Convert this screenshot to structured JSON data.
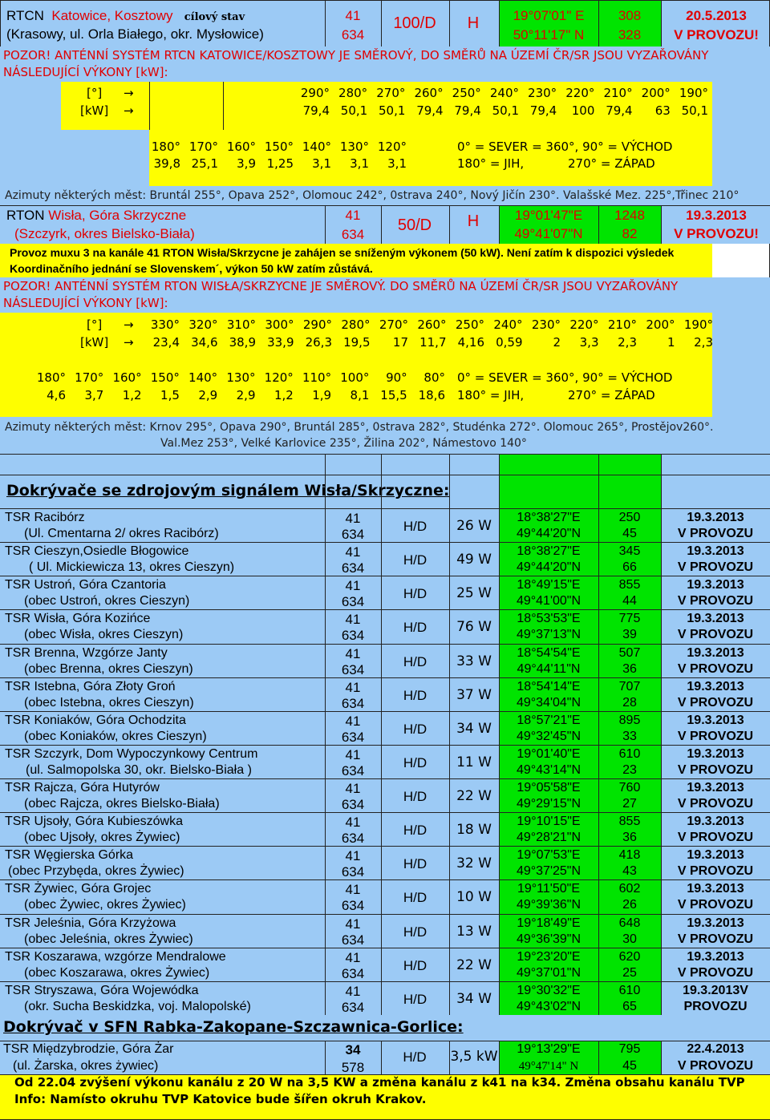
{
  "top": {
    "name1_prefix": "RTCN",
    "name1_city": "Katowice, Kosztowy",
    "name1_tag": "cílový stav",
    "name2": "(Krasowy, ul. Orla Białego, okr. Mysłowice)",
    "ch": "41",
    "freq": "634",
    "pol": "100/D",
    "pol2": "H",
    "lon": "19°07'01\" E",
    "lat": "50°11'17\" N",
    "alt1": "308",
    "alt2": "328",
    "date": "20.5.2013",
    "status": "V PROVOZU!"
  },
  "warn1": {
    "line1": "POZOR! ANTÉNNÍ SYSTÉM RTCN KATOWICE/KOSZTOWY JE SMĚROVÝ, DO SMĚRŮ NA ÚZEMÍ ČR/SR JSOU VYZAŘOVÁNY",
    "line2": "NÁSLEDUJÍCÍ VÝKONY [kW]:"
  },
  "k1": {
    "deg_label": "[°]",
    "kw_label": "[kW]",
    "arrow": "→",
    "deg": [
      "290°",
      "280°",
      "270°",
      "260°",
      "250°",
      "240°",
      "230°",
      "220°",
      "210°",
      "200°",
      "190°"
    ],
    "kw": [
      "79,4",
      "50,1",
      "50,1",
      "79,4",
      "79,4",
      "50,1",
      "79,4",
      "100",
      "79,4",
      "63",
      "50,1"
    ],
    "deg2": [
      "180°",
      "170°",
      "160°",
      "150°",
      "140°",
      "130°",
      "120°"
    ],
    "kw2": [
      "39,8",
      "25,1",
      "3,9",
      "1,25",
      "3,1",
      "3,1",
      "3,1"
    ],
    "leg1": "0° = SEVER = 360°, 90° = VÝCHOD",
    "leg2a": "180° = JIH,",
    "leg2b": "270° = ZÁPAD"
  },
  "az1": "Azimuty některých měst: Bruntál 255°, Opava 252°, Olomouc 242°, 0strava 240°, Nový Jičín 230°. Valašské Mez. 225°,Třinec 210°",
  "rton": {
    "name1_prefix": "RTON",
    "name1_city": "Wisła, Góra Skrzyczne",
    "name2": "(Szczyrk, okres Bielsko-Biała)",
    "ch": "41",
    "freq": "634",
    "pol": "50/D",
    "pol2": "H",
    "lon": "19°01'47\"E",
    "lat": "49°41'07\"N",
    "alt1": "1248",
    "alt2": "82",
    "date": "19.3.2013",
    "status": "V PROVOZU!",
    "note1": "Provoz muxu 3 na kanále 41 RTON Wisła/Skrzycne je zahájen se sníženým výkonem (50 kW). Není zatím k dispozici výsledek",
    "note2": "Koordinačního jednání se Slovenskem´, výkon 50 kW zatím zůstává."
  },
  "warn2": {
    "line1": "POZOR! ANTÉNNÍ SYSTÉM RTON WISŁA/SKRZYCNE JE SMĚROVÝ. DO SMĚRŮ NA ÚZEMÍ ČR/SR JSOU VYZAŘOVÁNY",
    "line2": "NÁSLEDUJÍCÍ VÝKONY [kW]:"
  },
  "k2": {
    "deg_label": "[°]",
    "kw_label": "[kW]",
    "arrow": "→",
    "deg": [
      "330°",
      "320°",
      "310°",
      "300°",
      "290°",
      "280°",
      "270°",
      "260°",
      "250°",
      "240°",
      "230°",
      "220°",
      "210°",
      "200°",
      "190°"
    ],
    "kw": [
      "23,4",
      "34,6",
      "38,9",
      "33,9",
      "26,3",
      "19,5",
      "17",
      "11,7",
      "4,16",
      "0,59",
      "2",
      "3,3",
      "2,3",
      "1",
      "2,3"
    ],
    "deg2": [
      "180°",
      "170°",
      "160°",
      "150°",
      "140°",
      "130°",
      "120°",
      "110°",
      "100°",
      "90°",
      "80°"
    ],
    "kw2": [
      "4,6",
      "3,7",
      "1,2",
      "1,5",
      "2,9",
      "2,9",
      "1,2",
      "1,9",
      "8,1",
      "15,5",
      "18,6"
    ],
    "leg1": "0° = SEVER = 360°, 90° = VÝCHOD",
    "leg2a": "180° = JIH,",
    "leg2b": "270° = ZÁPAD"
  },
  "az2": {
    "line1": "Azimuty některých měst: Krnov 295°, Opava 290°, Bruntál 285°, 0strava 282°, Studénka 272°. Olomouc 265°, Prostějov260°.",
    "line2": "Val.Mez 253°, Velké Karlovice 235°, Žilina 202°, Námestovo 140°"
  },
  "sec1_title": "Dokrývače se zdrojovým signálem Wisła/Skrzyczne:",
  "rows": [
    {
      "n1": "TSR Racibórz",
      "n2": "(Ul. Cmentarna 2/ okres Racibórz)",
      "ch": "41",
      "f": "634",
      "pol": "H/D",
      "pw": "26 W",
      "lon": "18°38'27\"E",
      "lat": "49°44'20\"N",
      "a1": "250",
      "a2": "45",
      "d": "19.3.2013",
      "s": "V PROVOZU"
    },
    {
      "n1": "TSR Cieszyn,Osiedle Błogowice",
      "n2": "( Ul. Mickiewicza 13, okres Cieszyn)",
      "ch": "41",
      "f": "634",
      "pol": "H/D",
      "pw": "49 W",
      "lon": "18°38'27\"E",
      "lat": "49°44'20\"N",
      "a1": "345",
      "a2": "66",
      "d": "19.3.2013",
      "s": "V PROVOZU"
    },
    {
      "n1": "TSR Ustroń, Góra Czantoria",
      "n2": "(obec Ustroń, okres Cieszyn)",
      "ch": "41",
      "f": "634",
      "pol": "H/D",
      "pw": "25 W",
      "lon": "18°49'15\"E",
      "lat": "49°41'00\"N",
      "a1": "855",
      "a2": "44",
      "d": "19.3.2013",
      "s": "V PROVOZU"
    },
    {
      "n1": "TSR Wisła, Góra Kozińce",
      "n2": "(obec Wisła, okres Cieszyn)",
      "ch": "41",
      "f": "634",
      "pol": "H/D",
      "pw": "76 W",
      "lon": "18°53'53\"E",
      "lat": "49°37'13\"N",
      "a1": "775",
      "a2": "39",
      "d": "19.3.2013",
      "s": "V PROVOZU"
    },
    {
      "n1": "TSR Brenna, Wzgórze Janty",
      "n2": "(obec Brenna, okres Cieszyn)",
      "ch": "41",
      "f": "634",
      "pol": "H/D",
      "pw": "33 W",
      "lon": "18°54'54\"E",
      "lat": "49°44'11\"N",
      "a1": "507",
      "a2": "36",
      "d": "19.3.2013",
      "s": "V PROVOZU"
    },
    {
      "n1": "TSR Istebna, Góra Złoty Groń",
      "n2": "(obec Istebna, okres Cieszyn)",
      "ch": "41",
      "f": "634",
      "pol": "H/D",
      "pw": "37 W",
      "lon": "18°54'14\"E",
      "lat": "49°34'04\"N",
      "a1": "707",
      "a2": "28",
      "d": "19.3.2013",
      "s": "V PROVOZU"
    },
    {
      "n1": "TSR Koniaków, Góra Ochodzita",
      "n2": "(obec Koniaków, okres Cieszyn)",
      "ch": "41",
      "f": "634",
      "pol": "H/D",
      "pw": "34 W",
      "lon": "18°57'21\"E",
      "lat": "49°32'45\"N",
      "a1": "895",
      "a2": "33",
      "d": "19.3.2013",
      "s": "V PROVOZU"
    },
    {
      "n1": "TSR Szczyrk, Dom Wypoczynkowy Centrum",
      "n2": "(ul. Salmopolska 30, okr. Bielsko-Biała )",
      "ch": "41",
      "f": "634",
      "pol": "H/D",
      "pw": "11 W",
      "lon": "19°01'40\"E",
      "lat": "49°43'14\"N",
      "a1": "610",
      "a2": "23",
      "d": "19.3.2013",
      "s": "V PROVOZU"
    },
    {
      "n1": "TSR Rajcza, Góra Hutyrów",
      "n2": "(obec Rajcza, okres Bielsko-Biała)",
      "ch": "41",
      "f": "634",
      "pol": "H/D",
      "pw": "22 W",
      "lon": "19°05'58\"E",
      "lat": "49°29'15\"N",
      "a1": "760",
      "a2": "27",
      "d": "19.3.2013",
      "s": "V PROVOZU"
    },
    {
      "n1": "TSR Ujsoły, Góra Kubieszówka",
      "n2": "(obec Ujsoły, okres Żywiec)",
      "ch": "41",
      "f": "634",
      "pol": "H/D",
      "pw": "18 W",
      "lon": "19°10'15\"E",
      "lat": "49°28'21\"N",
      "a1": "855",
      "a2": "36",
      "d": "19.3.2013",
      "s": "V PROVOZU"
    },
    {
      "n1": "TSR Węgierska Górka",
      "n2": "(obec Przybędа, okres Żywiec)",
      "ch": "41",
      "f": "634",
      "pol": "H/D",
      "pw": "32 W",
      "lon": "19°07'53\"E",
      "lat": "49°37'25\"N",
      "a1": "418",
      "a2": "43",
      "d": "19.3.2013",
      "s": "V PROVOZU"
    },
    {
      "n1": "TSR Żywiec, Góra Grojec",
      "n2": "(obec Żywiec, okres Żywiec)",
      "ch": "41",
      "f": "634",
      "pol": "H/D",
      "pw": "10 W",
      "lon": "19°11'50\"E",
      "lat": "49°39'36\"N",
      "a1": "602",
      "a2": "26",
      "d": "19.3.2013",
      "s": "V PROVOZU"
    },
    {
      "n1": "TSR Jeleśnia, Góra Krzyżowa",
      "n2": "(obec Jeleśnia, okres Żywiec)",
      "ch": "41",
      "f": "634",
      "pol": "H/D",
      "pw": "13 W",
      "lon": "19°18'49\"E",
      "lat": "49°36'39\"N",
      "a1": "648",
      "a2": "30",
      "d": "19.3.2013",
      "s": "V PROVOZU"
    },
    {
      "n1": "TSR Koszarawa, wzgórze Mendralowe",
      "n2": "(obec Koszarawa, okres Żywiec)",
      "ch": "41",
      "f": "634",
      "pol": "H/D",
      "pw": "22 W",
      "lon": "19°23'20\"E",
      "lat": "49°37'01\"N",
      "a1": "620",
      "a2": "25",
      "d": "19.3.2013",
      "s": "V PROVOZU"
    },
    {
      "n1": "TSR Stryszawa, Góra Wojewódka",
      "n2": "(okr. Sucha Beskidzka, voj. Malopolské)",
      "ch": "41",
      "f": "634",
      "pol": "H/D",
      "pw": "34 W",
      "lon": "19°30'32\"E",
      "lat": "49°43'02\"N",
      "a1": "610",
      "a2": "65",
      "d": "19.3.2013V",
      "s": "PROVOZU"
    }
  ],
  "sec2_title": "Dokrývač v SFN Rabka-Zakopane-Szczawnica-Gorlice:",
  "last": {
    "n1": "TSR Międzybrodzie, Góra Żar",
    "n2": "(ul. Żarska, okres żywiec)",
    "ch": "34",
    "f": "578",
    "pol": "H/D",
    "pw": "3,5 kW",
    "lon": "19°13'29\"E",
    "lat": "49°47'14\" N",
    "a1": "795",
    "a2": "45",
    "d": "22.4.2013",
    "s": "V PROVOZU"
  },
  "foot": {
    "line1": "Od 22.04 zvýšení výkonu kanálu z 20 W na 3,5 KW a změna kanálu z k41 na k34. Změna obsahu kanálu TVP",
    "line2": "Info: Namísto okruhu TVP Katovice bude šířen okruh Krakov."
  }
}
